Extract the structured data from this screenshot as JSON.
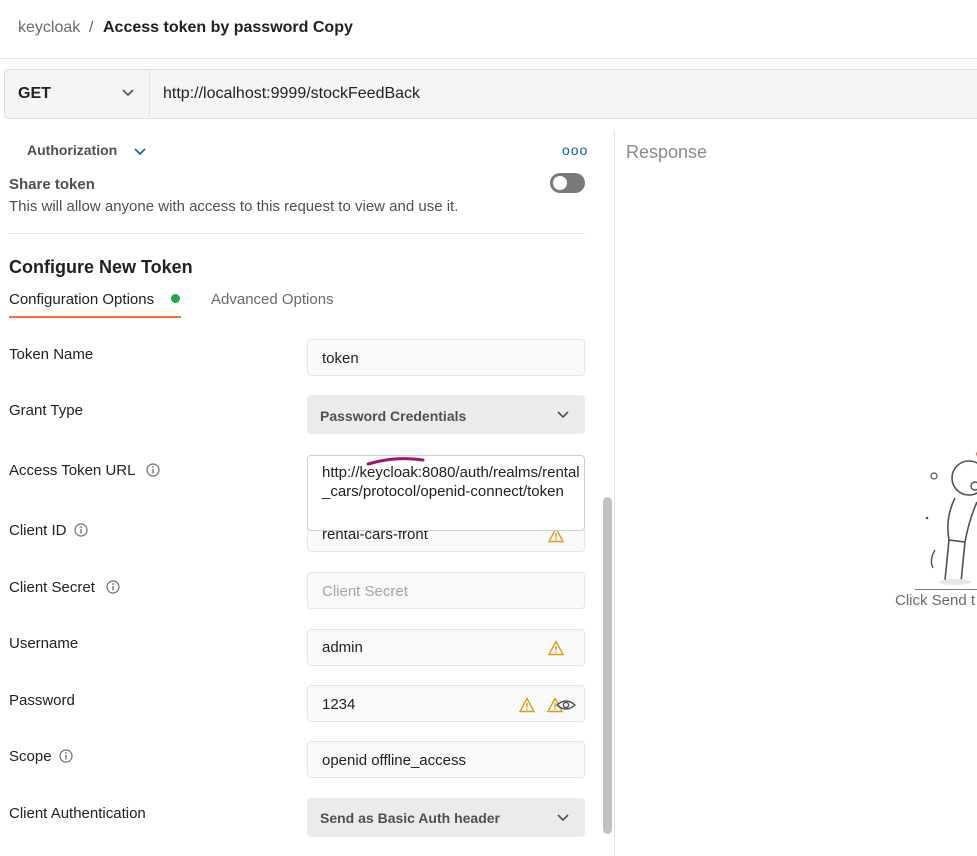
{
  "header": {
    "collection": "keycloak",
    "separator": "/",
    "request_name": "Access token by password Copy"
  },
  "request": {
    "method": "GET",
    "url": "http://localhost:9999/stockFeedBack"
  },
  "auth": {
    "section_label": "Authorization",
    "more_label": "ooo",
    "share_title": "Share token",
    "share_desc": "This will allow anyone with access to this request to view and use it.",
    "share_enabled": false,
    "config_title": "Configure New Token",
    "tabs": [
      {
        "label": "Configuration Options",
        "active": true
      },
      {
        "label": "Advanced Options",
        "active": false
      }
    ],
    "fields": {
      "token_name": {
        "label": "Token Name",
        "value": "token"
      },
      "grant_type": {
        "label": "Grant Type",
        "value": "Password Credentials"
      },
      "access_token_url": {
        "label": "Access Token URL",
        "value": "http://keycloak:8080/auth/realms/rental_cars/protocol/openid-connect/token"
      },
      "client_id": {
        "label": "Client ID",
        "value": "rental-cars-front"
      },
      "client_secret": {
        "label": "Client Secret",
        "placeholder": "Client Secret"
      },
      "username": {
        "label": "Username",
        "value": "admin"
      },
      "password": {
        "label": "Password",
        "value": "1234"
      },
      "scope": {
        "label": "Scope",
        "value": "openid offline_access"
      },
      "client_auth": {
        "label": "Client Authentication",
        "value": "Send as Basic Auth header"
      }
    }
  },
  "response": {
    "title": "Response",
    "hint": "Click Send t"
  },
  "colors": {
    "accent": "#ff6c37",
    "success_dot": "#1ba94c",
    "warning": "#d4a017",
    "annotation": "#a0156a"
  }
}
